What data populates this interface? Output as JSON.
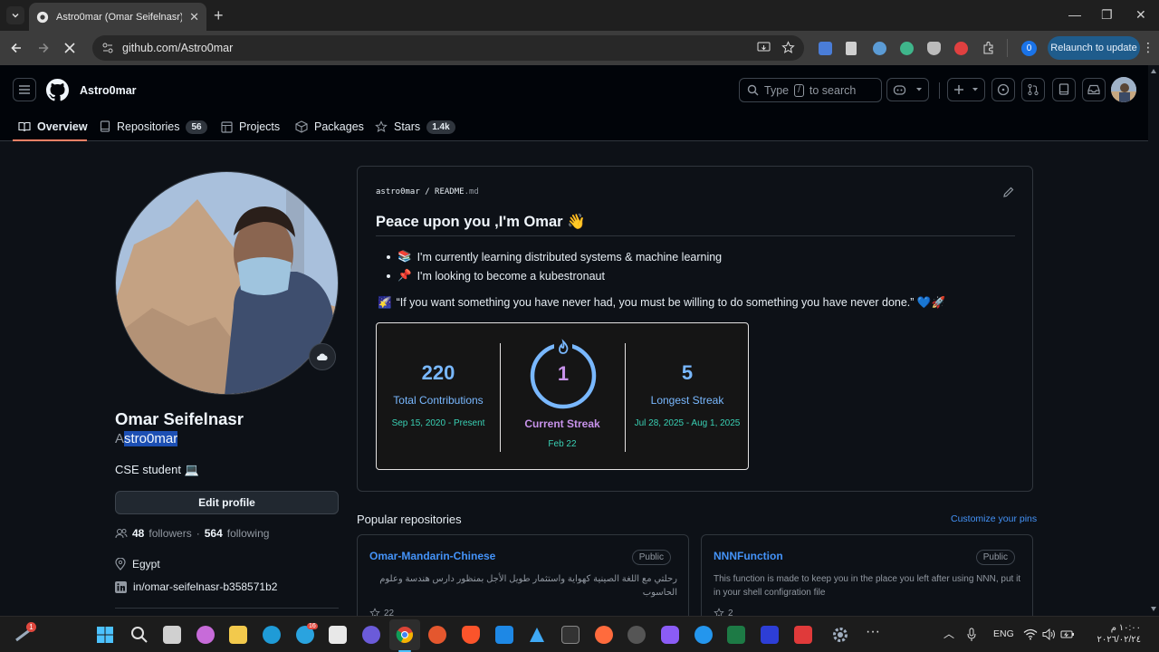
{
  "browser": {
    "tab_title": "Astro0mar (Omar Seifelnasr)",
    "url": "github.com/Astro0mar",
    "relaunch_label": "Relaunch to update",
    "profile_badge": "0"
  },
  "header": {
    "username": "Astro0mar",
    "search_prefix": "Type",
    "search_key": "/",
    "search_suffix": "to search"
  },
  "nav": {
    "tabs": [
      {
        "label": "Overview"
      },
      {
        "label": "Repositories",
        "count": "56"
      },
      {
        "label": "Projects"
      },
      {
        "label": "Packages"
      },
      {
        "label": "Stars",
        "count": "1.4k"
      }
    ]
  },
  "profile": {
    "name": "Omar Seifelnasr",
    "login_first": "A",
    "login_rest": "stro0mar",
    "bio": "CSE student 💻",
    "edit_label": "Edit profile",
    "followers": "48",
    "followers_label": "followers",
    "separator": "·",
    "following": "564",
    "following_label": "following",
    "location": "Egypt",
    "linkedin": "in/omar-seifelnasr-b358571b2"
  },
  "readme": {
    "crumb_user": "astro0mar",
    "crumb_sep": "/",
    "crumb_file": "README",
    "crumb_ext": ".md",
    "heading": "Peace upon you ,I'm Omar 👋",
    "items": [
      {
        "emoji": "📚",
        "text": "I'm currently learning distributed systems & machine learning"
      },
      {
        "emoji": "📌",
        "text": "I'm looking to become a kubestronaut"
      }
    ],
    "quote_emoji": "🌠",
    "quote": "“If you want something you have never had, you must be willing to do something you have never done.” 💙🚀"
  },
  "streak": {
    "total": "220",
    "total_label": "Total Contributions",
    "total_range": "Sep 15, 2020 - Present",
    "current": "1",
    "current_label": "Current Streak",
    "current_date": "Feb 22",
    "longest": "5",
    "longest_label": "Longest Streak",
    "longest_range": "Jul 28, 2025 - Aug 1, 2025"
  },
  "popular": {
    "title": "Popular repositories",
    "customize": "Customize your pins",
    "repos": [
      {
        "name": "Omar-Mandarin-Chinese",
        "visibility": "Public",
        "description": "رحلتي مع اللغة الصينية كهواية واستثمار طويل الأجل بمنظور دارس هندسة وعلوم الحاسوب",
        "stars": "22"
      },
      {
        "name": "NNNFunction",
        "visibility": "Public",
        "description": "This function is made to keep you in the place you left after using NNN, put it in your shell configration file",
        "stars": "2"
      }
    ]
  },
  "taskbar": {
    "notif_badge": "1",
    "telegram_badge": "16",
    "lang": "ENG",
    "time": "١٠:٠٠ م",
    "date": "٢٠٢٦/٠٢/٢٤"
  },
  "colors": {
    "accent": "#4493f8",
    "streak_blue": "#79b8ff",
    "streak_purple": "#c792ea",
    "streak_green": "#39d0b4",
    "underline": "#f78166"
  }
}
